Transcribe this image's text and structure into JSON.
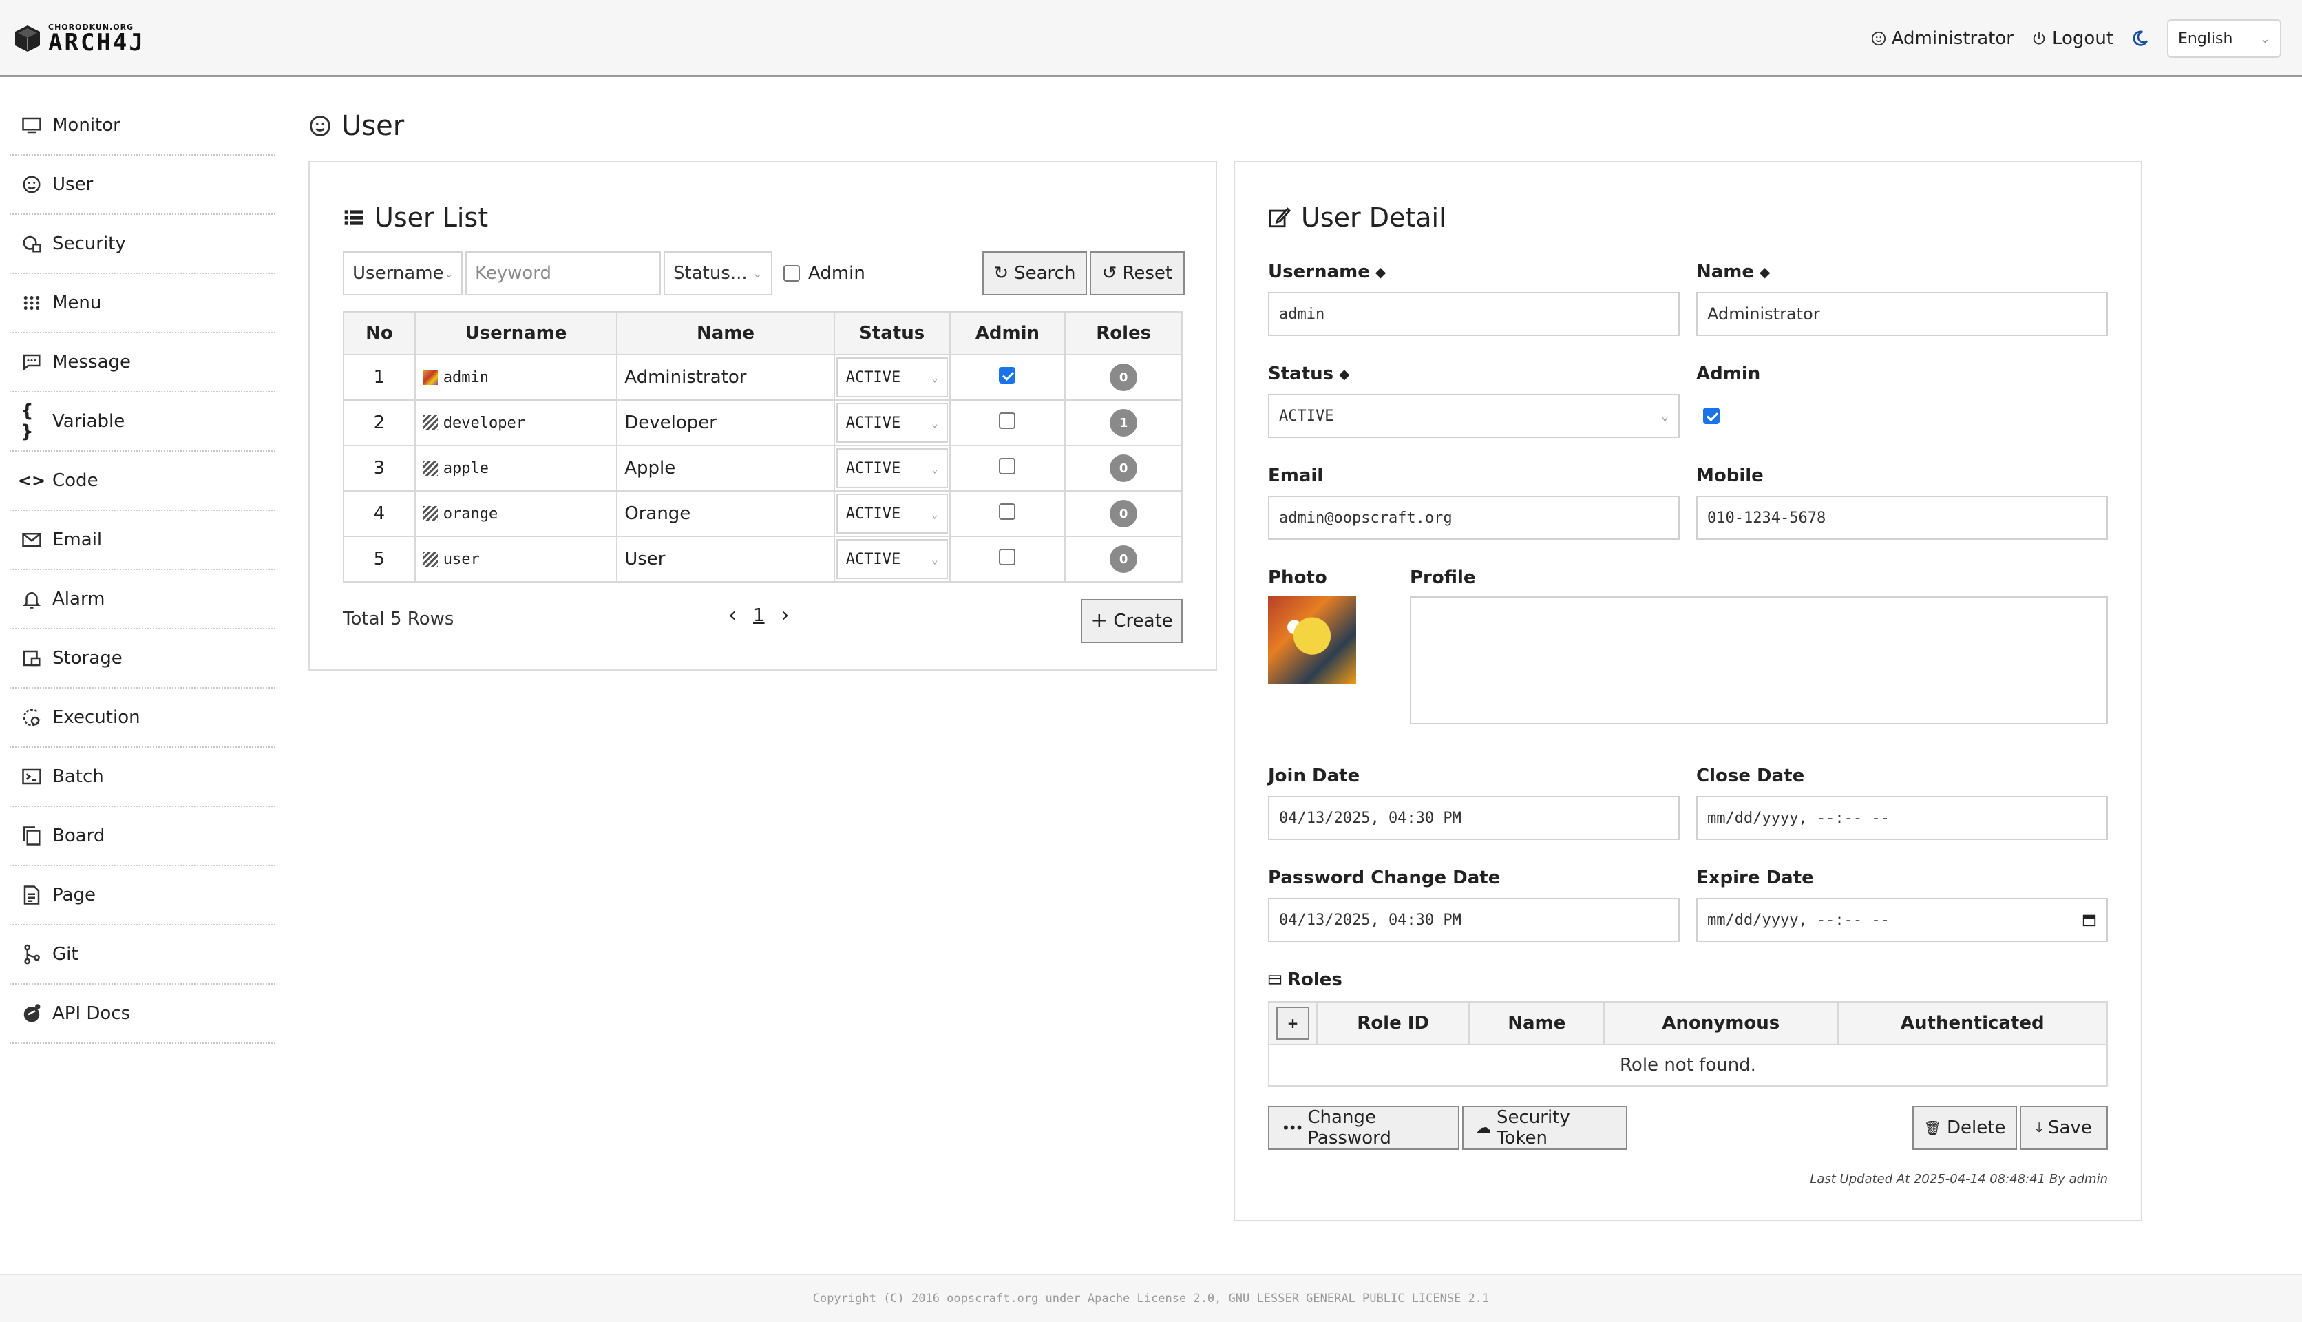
{
  "header": {
    "logo_small": "CHORODKUN.ORG",
    "logo_big": "ARCH4J",
    "user_label": "Administrator",
    "logout_label": "Logout",
    "language": "English"
  },
  "sidebar": {
    "items": [
      {
        "label": "Monitor",
        "icon": "monitor-icon"
      },
      {
        "label": "User",
        "icon": "user-icon"
      },
      {
        "label": "Security",
        "icon": "security-icon"
      },
      {
        "label": "Menu",
        "icon": "menu-icon"
      },
      {
        "label": "Message",
        "icon": "message-icon"
      },
      {
        "label": "Variable",
        "icon": "variable-icon"
      },
      {
        "label": "Code",
        "icon": "code-icon"
      },
      {
        "label": "Email",
        "icon": "email-icon"
      },
      {
        "label": "Alarm",
        "icon": "alarm-icon"
      },
      {
        "label": "Storage",
        "icon": "storage-icon"
      },
      {
        "label": "Execution",
        "icon": "execution-icon"
      },
      {
        "label": "Batch",
        "icon": "batch-icon"
      },
      {
        "label": "Board",
        "icon": "board-icon"
      },
      {
        "label": "Page",
        "icon": "page-icon"
      },
      {
        "label": "Git",
        "icon": "git-icon"
      },
      {
        "label": "API Docs",
        "icon": "api-docs-icon"
      }
    ]
  },
  "page": {
    "title": "User"
  },
  "user_list": {
    "title": "User List",
    "search": {
      "field_select": "Username",
      "keyword_placeholder": "Keyword",
      "status_select": "Status...",
      "admin_label": "Admin",
      "search_button": "Search",
      "reset_button": "Reset"
    },
    "columns": [
      "No",
      "Username",
      "Name",
      "Status",
      "Admin",
      "Roles"
    ],
    "rows": [
      {
        "no": "1",
        "username": "admin",
        "name": "Administrator",
        "status": "ACTIVE",
        "admin": true,
        "roles": "0",
        "photo": true
      },
      {
        "no": "2",
        "username": "developer",
        "name": "Developer",
        "status": "ACTIVE",
        "admin": false,
        "roles": "1",
        "photo": false
      },
      {
        "no": "3",
        "username": "apple",
        "name": "Apple",
        "status": "ACTIVE",
        "admin": false,
        "roles": "0",
        "photo": false
      },
      {
        "no": "4",
        "username": "orange",
        "name": "Orange",
        "status": "ACTIVE",
        "admin": false,
        "roles": "0",
        "photo": false
      },
      {
        "no": "5",
        "username": "user",
        "name": "User",
        "status": "ACTIVE",
        "admin": false,
        "roles": "0",
        "photo": false
      }
    ],
    "total": "Total 5 Rows",
    "page": "1",
    "create_button": "Create"
  },
  "user_detail": {
    "title": "User Detail",
    "username_label": "Username",
    "username_value": "admin",
    "name_label": "Name",
    "name_value": "Administrator",
    "status_label": "Status",
    "status_value": "ACTIVE",
    "admin_label": "Admin",
    "admin_checked": true,
    "email_label": "Email",
    "email_value": "admin@oopscraft.org",
    "mobile_label": "Mobile",
    "mobile_value": "010-1234-5678",
    "photo_label": "Photo",
    "profile_label": "Profile",
    "join_date_label": "Join Date",
    "join_date_value": "04/13/2025, 04:30 PM",
    "close_date_label": "Close Date",
    "close_date_value": "mm/dd/yyyy, --:-- --",
    "password_change_label": "Password Change Date",
    "password_change_value": "04/13/2025, 04:30 PM",
    "expire_date_label": "Expire Date",
    "expire_date_value": "mm/dd/yyyy, --:-- --",
    "roles_label": "Roles",
    "roles_add": "+",
    "roles_columns": [
      "Role ID",
      "Name",
      "Anonymous",
      "Authenticated"
    ],
    "roles_empty": "Role not found.",
    "change_password_button": "Change Password",
    "security_token_button": "Security Token",
    "delete_button": "Delete",
    "save_button": "Save",
    "last_updated": "Last Updated At 2025-04-14 08:48:41 By admin"
  },
  "footer": {
    "copyright": "Copyright (C) 2016 oopscraft.org under Apache License 2.0, GNU LESSER GENERAL PUBLIC LICENSE 2.1"
  }
}
